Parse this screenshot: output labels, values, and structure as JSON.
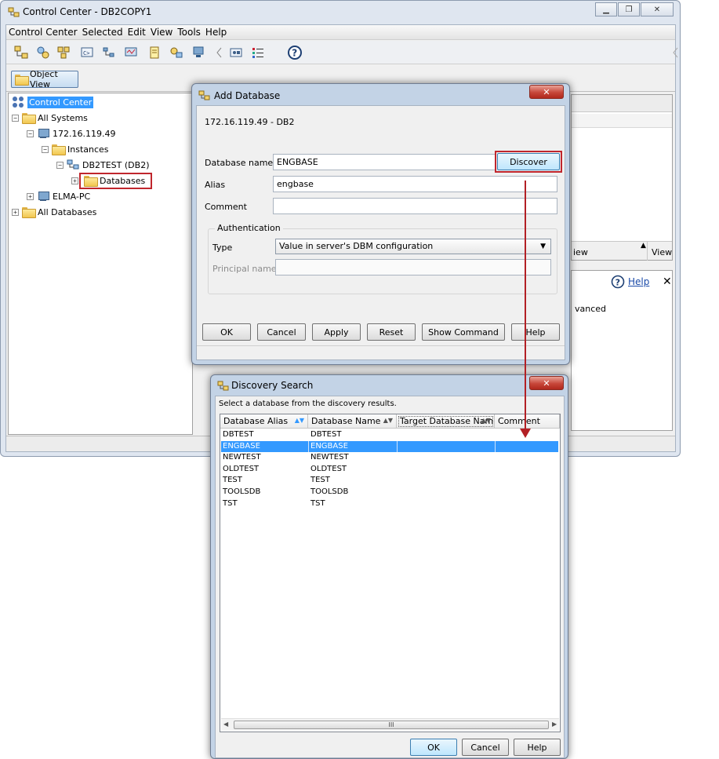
{
  "main_window": {
    "title": "Control Center - DB2COPY1",
    "menu": [
      "Control Center",
      "Selected",
      "Edit",
      "View",
      "Tools",
      "Help"
    ],
    "object_view_label": "Object View",
    "tree": [
      {
        "label": "Control Center"
      },
      {
        "label": "All Systems"
      },
      {
        "label": "172.16.119.49"
      },
      {
        "label": "Instances"
      },
      {
        "label": "DB2TEST (DB2)"
      },
      {
        "label": "Databases"
      },
      {
        "label": "ELMA-PC"
      },
      {
        "label": "All Databases"
      }
    ],
    "right_fragments": {
      "view_partial": "iew",
      "view_button": "View",
      "help_link": "Help",
      "advanced_partial": "vanced"
    }
  },
  "add_database": {
    "title": "Add Database",
    "subtitle": "172.16.119.49 - DB2",
    "db_name_label": "Database name",
    "db_name_value": "ENGBASE",
    "discover_label": "Discover",
    "alias_label": "Alias",
    "alias_value": "engbase",
    "comment_label": "Comment",
    "comment_value": "",
    "auth_legend": "Authentication",
    "type_label": "Type",
    "type_value": "Value in server's DBM configuration",
    "principal_label": "Principal name",
    "principal_value": "",
    "buttons": [
      "OK",
      "Cancel",
      "Apply",
      "Reset",
      "Show Command",
      "Help"
    ]
  },
  "discovery": {
    "title": "Discovery Search",
    "instruction": "Select a database from the discovery results.",
    "columns": [
      "Database Alias",
      "Database Name",
      "Target Database Name",
      "Comment"
    ],
    "rows": [
      [
        "DBTEST",
        "DBTEST",
        "",
        ""
      ],
      [
        "ENGBASE",
        "ENGBASE",
        "",
        ""
      ],
      [
        "NEWTEST",
        "NEWTEST",
        "",
        ""
      ],
      [
        "OLDTEST",
        "OLDTEST",
        "",
        ""
      ],
      [
        "TEST",
        "TEST",
        "",
        ""
      ],
      [
        "TOOLSDB",
        "TOOLSDB",
        "",
        ""
      ],
      [
        "TST",
        "TST",
        "",
        ""
      ]
    ],
    "selected_row": 1,
    "scroll_grip": "III",
    "buttons": [
      "OK",
      "Cancel",
      "Help"
    ]
  },
  "colors": {
    "highlight_red": "#c0262d",
    "selection_blue": "#3399ff",
    "close_red": "#c7473a"
  }
}
